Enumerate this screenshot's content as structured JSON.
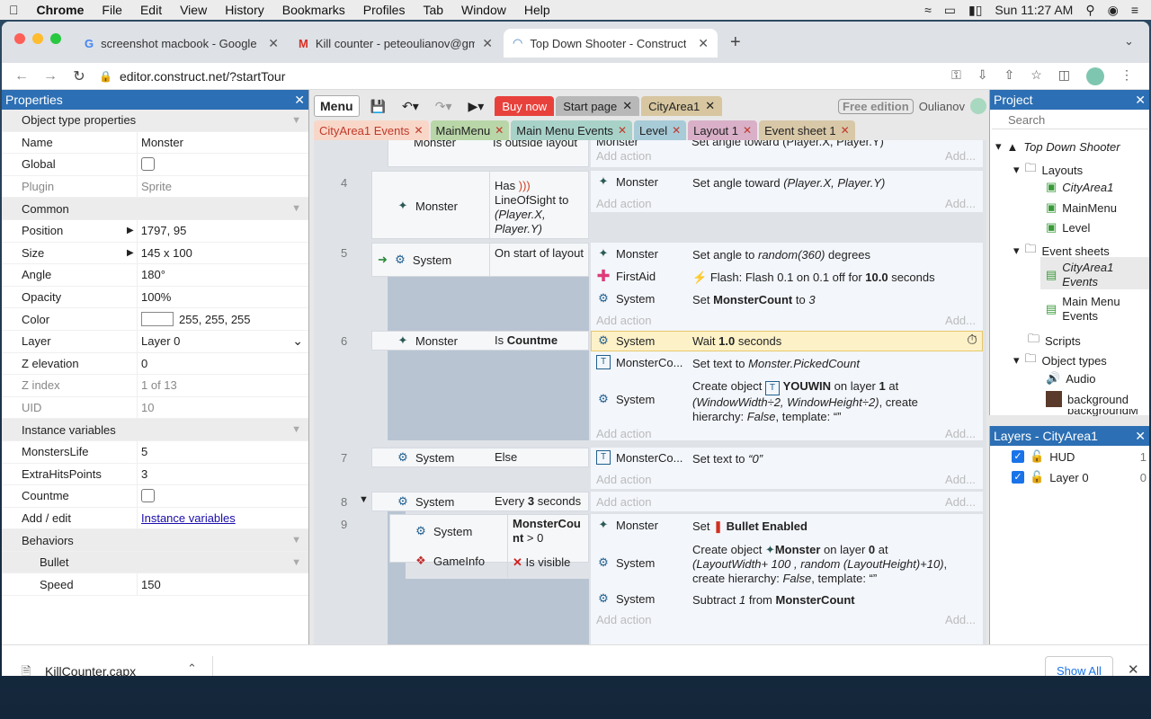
{
  "menubar": {
    "app": "Chrome",
    "items": [
      "File",
      "Edit",
      "View",
      "History",
      "Bookmarks",
      "Profiles",
      "Tab",
      "Window",
      "Help"
    ],
    "clock": "Sun 11:27 AM"
  },
  "browser": {
    "tabs": [
      {
        "title": "screenshot macbook - Google"
      },
      {
        "title": "Kill counter - peteoulianov@gm"
      },
      {
        "title": "Top Down Shooter - Construct"
      }
    ],
    "url": "editor.construct.net/?startTour"
  },
  "properties": {
    "title": "Properties",
    "rows": [
      {
        "type": "section",
        "k": "Object type properties"
      },
      {
        "k": "Name",
        "v": "Monster"
      },
      {
        "k": "Global",
        "v": "",
        "check": true
      },
      {
        "k": "Plugin",
        "v": "Sprite",
        "grey": true
      },
      {
        "type": "section",
        "k": "Common"
      },
      {
        "k": "Position",
        "v": "1797, 95",
        "arrow": true
      },
      {
        "k": "Size",
        "v": "145 x 100",
        "arrow": true
      },
      {
        "k": "Angle",
        "v": "180°"
      },
      {
        "k": "Opacity",
        "v": "100%"
      },
      {
        "k": "Color",
        "v": "255, 255, 255",
        "swatch": true
      },
      {
        "k": "Layer",
        "v": "Layer 0",
        "select": true
      },
      {
        "k": "Z elevation",
        "v": "0"
      },
      {
        "k": "Z index",
        "v": "1 of 13",
        "grey": true
      },
      {
        "k": "UID",
        "v": "10",
        "grey": true
      },
      {
        "type": "section",
        "k": "Instance variables"
      },
      {
        "k": "MonstersLife",
        "v": "5"
      },
      {
        "k": "ExtraHitsPoints",
        "v": "3"
      },
      {
        "k": "Countme",
        "v": "",
        "check": true
      },
      {
        "k": "Add / edit",
        "v": "Instance variables",
        "link": true
      },
      {
        "type": "section",
        "k": "Behaviors"
      },
      {
        "type": "subsection",
        "k": "Bullet"
      },
      {
        "k": "Speed",
        "v": "150",
        "indent": true
      }
    ]
  },
  "toolbar": {
    "menu": "Menu",
    "buy_now": "Buy now",
    "start_page": "Start page",
    "city_area": "CityArea1",
    "free_edition": "Free edition",
    "user": "Oulianov"
  },
  "doc_tabs": [
    {
      "label": "CityArea1 Events",
      "bg": "#f8d7c8",
      "color": "#c0392b"
    },
    {
      "label": "MainMenu",
      "bg": "#b9d6a8",
      "color": "#222"
    },
    {
      "label": "Main Menu Events",
      "bg": "#a8d2c8",
      "color": "#222"
    },
    {
      "label": "Level",
      "bg": "#a8cbd8",
      "color": "#222"
    },
    {
      "label": "Layout 1",
      "bg": "#d9b0c8",
      "color": "#222"
    },
    {
      "label": "Event sheet 1",
      "bg": "#d8c8a8",
      "color": "#222"
    }
  ],
  "events": {
    "add_action": "Add action",
    "add_short": "Add...",
    "e3": {
      "obj": "Monster",
      "cond": "Is outside layout",
      "act_obj": "Monster",
      "act": "Set angle toward (Player.X, Player.Y)"
    },
    "e4": {
      "num": "4",
      "obj": "Monster",
      "cond_a": "Has",
      "cond_b": "LineOfSight to",
      "cond_c": "(Player.X,",
      "cond_d": "Player.Y)",
      "act_obj": "Monster",
      "act": "Set angle toward ",
      "act_i": "(Player.X, Player.Y)"
    },
    "e5": {
      "num": "5",
      "obj": "System",
      "cond": "On start of layout",
      "a1_obj": "Monster",
      "a1": "Set angle to ",
      "a1_i": "random(360)",
      "a1_t": " degrees",
      "a2_obj": "FirstAid",
      "a2": "Flash: Flash 0.1 on 0.1 off for ",
      "a2_b": "10.0",
      "a2_t": " seconds",
      "a3_obj": "System",
      "a3": "Set ",
      "a3_b": "MonsterCount",
      "a3_t": " to ",
      "a3_i": "3"
    },
    "e6": {
      "num": "6",
      "obj": "Monster",
      "cond": "Is ",
      "cond_b": "Countme",
      "a1_obj": "System",
      "a1": "Wait ",
      "a1_b": "1.0",
      "a1_t": " seconds",
      "a2_obj": "MonsterCo...",
      "a2": "Set text to ",
      "a2_i": "Monster.PickedCount",
      "a3_obj": "System",
      "a3_l1": "Create object ",
      "a3_b1": "YOUWIN",
      "a3_l1b": " on layer ",
      "a3_b2": "1",
      "a3_l1c": " at",
      "a3_l2": "(WindowWidth÷2, WindowHeight÷2)",
      "a3_l2b": ", create",
      "a3_l3": "hierarchy: ",
      "a3_l3i": "False",
      "a3_l3b": ", template: ",
      "a3_l3c": "“”"
    },
    "e7": {
      "num": "7",
      "obj": "System",
      "cond": "Else",
      "a1_obj": "MonsterCo...",
      "a1": "Set text to ",
      "a1_i": "“0”"
    },
    "e8": {
      "num": "8",
      "obj": "System",
      "cond": "Every ",
      "cond_b": "3",
      "cond_t": " seconds"
    },
    "e9": {
      "num": "9",
      "o1": "System",
      "o2": "GameInfo",
      "c1": "MonsterCou",
      "c1b": "nt",
      "c1t": " > 0",
      "c2": "Is visible",
      "a1_obj": "Monster",
      "a1": "Set ",
      "a1_b": "Bullet Enabled",
      "a2_obj": "System",
      "a2_l1": "Create object ",
      "a2_b1": "Monster",
      "a2_l1b": " on layer ",
      "a2_b2": "0",
      "a2_l1c": " at",
      "a2_l2": "(LayoutWidth+ 100 , random (LayoutHeight)+10)",
      "a2_l2b": ",",
      "a2_l3": "create hierarchy: ",
      "a2_l3i": "False",
      "a2_l3b": ", template: ",
      "a2_l3c": "“”",
      "a3_obj": "System",
      "a3": "Subtract ",
      "a3_i": "1",
      "a3_t": " from ",
      "a3_b": "MonsterCount"
    }
  },
  "project": {
    "title": "Project",
    "search": "Search",
    "root": "Top Down Shooter",
    "layouts": "Layouts",
    "l1": "CityArea1",
    "l2": "MainMenu",
    "l3": "Level",
    "sheets": "Event sheets",
    "s1": "CityArea1 Events",
    "s2": "Main Menu Events",
    "scripts": "Scripts",
    "types": "Object types",
    "t1": "Audio",
    "t2": "background",
    "t3": "backgroundM"
  },
  "layers": {
    "title": "Layers - CityArea1",
    "items": [
      {
        "name": "HUD",
        "n": "1"
      },
      {
        "name": "Layer 0",
        "n": "0"
      }
    ]
  },
  "download": {
    "file": "KillCounter.capx",
    "show_all": "Show All"
  }
}
